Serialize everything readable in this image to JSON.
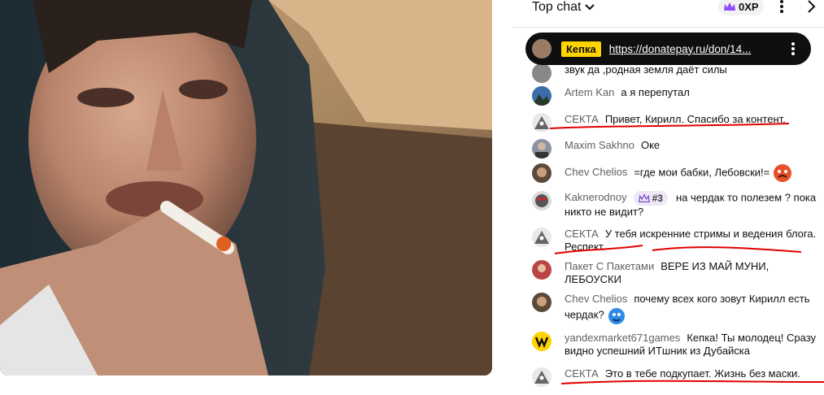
{
  "header": {
    "chat_mode": "Top chat",
    "xp_label": "0XP"
  },
  "pinned": {
    "author": "Кепка",
    "link": "https://donatepay.ru/don/14..."
  },
  "partial_message": {
    "text": "звук да ,родная земля даёт силы"
  },
  "messages": [
    {
      "name": "Artem Kan",
      "text": "а я перепутал",
      "avatar": "mountain"
    },
    {
      "name": "СЕКТА",
      "text": "Привет, Кирилл. Спасибо за контент.",
      "avatar": "pyramid-eye"
    },
    {
      "name": "Maxim Sakhno",
      "text": "Оке",
      "avatar": "photo"
    },
    {
      "name": "Chev Chelios",
      "text": "=где мои бабки, Лебовски!=",
      "avatar": "face"
    },
    {
      "name": "Kaknerodnoy",
      "badge": "#3",
      "text": "на чердак то полезем ? пока никто не видит?",
      "avatar": "gas-mask"
    },
    {
      "name": "СЕКТА",
      "text": "У тебя искренние стримы и ведения блога. Респект.",
      "avatar": "pyramid-eye"
    },
    {
      "name": "Пакет С Пакетами",
      "text": "ВЕРЕ ИЗ МАЙ МУНИ, ЛЕБОУСКИ",
      "avatar": "red"
    },
    {
      "name": "Chev Chelios",
      "text": "почему всех кого зовут Кирилл есть чердак?",
      "avatar": "face"
    },
    {
      "name": "yandexmarket671games",
      "text": "Кепка! Ты молодец! Сразу видно успешний ИТшник из Дубайска",
      "avatar": "yandex"
    },
    {
      "name": "СЕКТА",
      "text": "Это в тебе подкупает. Жизнь без маски.",
      "avatar": "pyramid-eye"
    }
  ],
  "colors": {
    "pinned_bg": "#0f0f0f",
    "pinned_author_bg": "#ffd400",
    "annotation_red": "#e00000",
    "member_badge_bg": "#ede7f6"
  }
}
